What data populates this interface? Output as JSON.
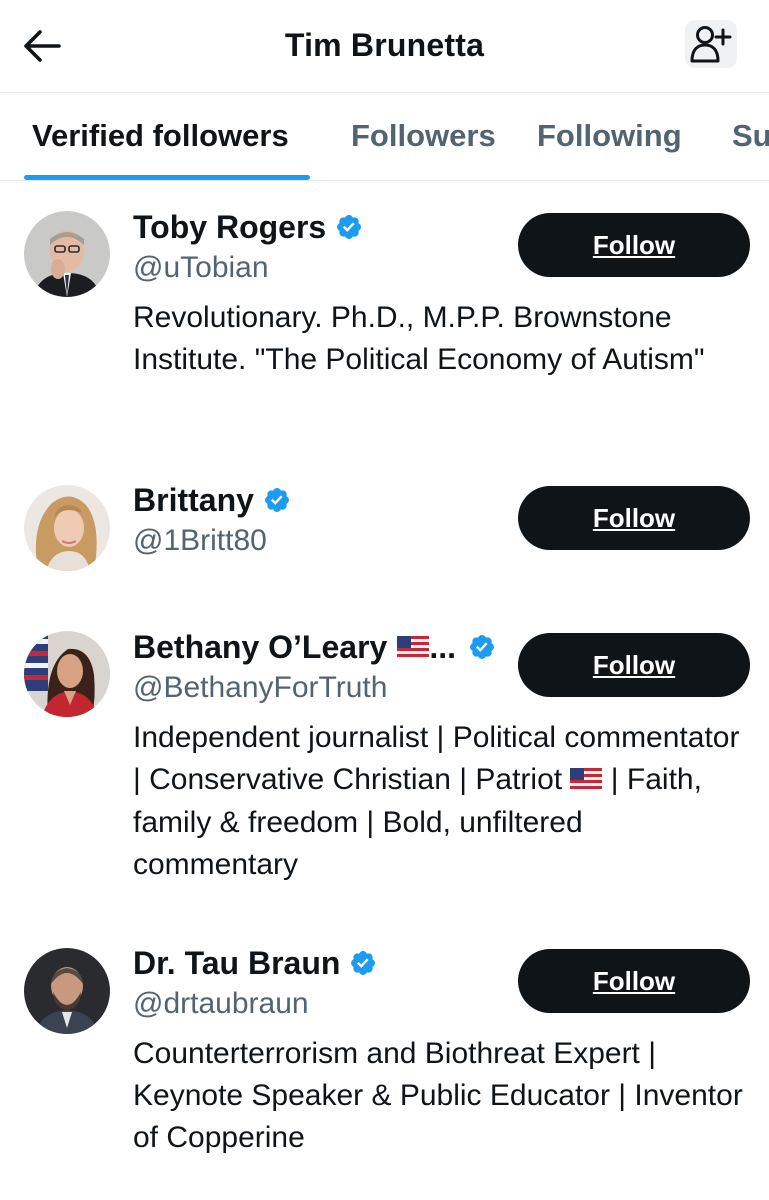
{
  "header": {
    "title": "Tim Brunetta",
    "back_icon": "arrow-left-icon",
    "add_icon": "person-add-icon"
  },
  "tabs": [
    {
      "label": "Verified followers",
      "active": true
    },
    {
      "label": "Followers",
      "active": false
    },
    {
      "label": "Following",
      "active": false
    },
    {
      "label": "Su",
      "active": false
    }
  ],
  "colors": {
    "accent": "#1d9bf0",
    "text": "#0f1419",
    "muted": "#536471",
    "button_bg": "#0f1419"
  },
  "users": [
    {
      "name": "Toby Rogers",
      "handle": "@uTobian",
      "bio": "Revolutionary. Ph.D., M.P.P. Brownstone Institute. \"The Political Economy of Autism\"",
      "follow_label": "Follow",
      "verified": true
    },
    {
      "name": "Brittany",
      "handle": "@1Britt80",
      "bio": "",
      "follow_label": "Follow",
      "verified": true
    },
    {
      "name": "Bethany O’Leary",
      "name_suffix": "...",
      "handle": "@BethanyForTruth",
      "bio_part1": "Independent journalist | Political commentator | Conservative Christian | Patriot",
      "bio_part2": " | Faith, family & freedom | Bold, unfiltered commentary",
      "follow_label": "Follow",
      "verified": true
    },
    {
      "name": "Dr. Tau Braun",
      "handle": "@drtaubraun",
      "bio": "Counterterrorism and Biothreat Expert | Keynote Speaker & Public Educator | Inventor of Copperine",
      "follow_label": "Follow",
      "verified": true
    }
  ]
}
